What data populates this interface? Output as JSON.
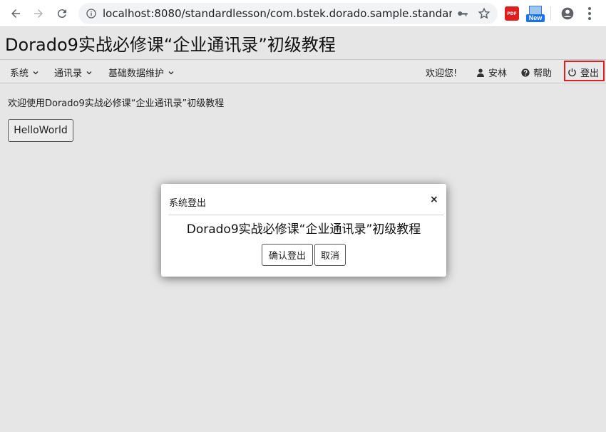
{
  "browser": {
    "url": "localhost:8080/standardlesson/com.bstek.dorado.sample.standardless...",
    "ext_pdf_label": "PDF",
    "ext_new_label": "New"
  },
  "app": {
    "title": "Dorado9实战必修课“企业通讯录”初级教程"
  },
  "menu": {
    "items": [
      {
        "label": "系统"
      },
      {
        "label": "通讯录"
      },
      {
        "label": "基础数据维护"
      }
    ],
    "welcome": "欢迎您!",
    "user": "安林",
    "help": "帮助",
    "logout": "登出"
  },
  "content": {
    "welcome_text": "欢迎使用Dorado9实战必修课“企业通讯录”初级教程",
    "hello_button": "HelloWorld"
  },
  "dialog": {
    "title": "系统登出",
    "close": "×",
    "message": "Dorado9实战必修课“企业通讯录”初级教程",
    "confirm": "确认登出",
    "cancel": "取消"
  },
  "colors": {
    "highlight_border": "#e02020",
    "page_bg": "#e6e6e6"
  }
}
